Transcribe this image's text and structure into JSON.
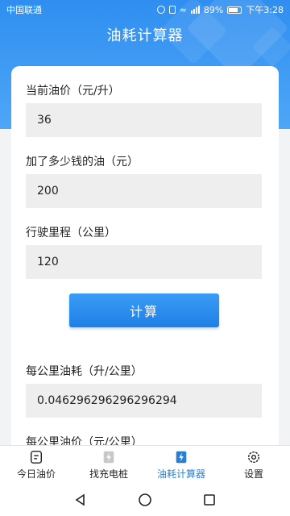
{
  "status_bar": {
    "carrier": "中国联通",
    "battery": "89%",
    "time": "下午3:28"
  },
  "header": {
    "title": "油耗计算器"
  },
  "form": {
    "price_label": "当前油价（元/升）",
    "price_value": "36",
    "cost_label": "加了多少钱的油（元）",
    "cost_value": "200",
    "distance_label": "行驶里程（公里）",
    "distance_value": "120",
    "calc_button": "计算"
  },
  "results": {
    "consumption_label": "每公里油耗（升/公里）",
    "consumption_value": "0.046296296296296294",
    "price_per_km_label": "每公里油价（元/公里）"
  },
  "tabs": [
    {
      "label": "今日油价",
      "icon": "oil-price-icon",
      "active": false
    },
    {
      "label": "找充电桩",
      "icon": "charging-icon",
      "active": false
    },
    {
      "label": "油耗计算器",
      "icon": "calculator-icon",
      "active": true
    },
    {
      "label": "设置",
      "icon": "settings-gear-icon",
      "active": false
    }
  ],
  "colors": {
    "accent": "#2a7fd4",
    "header": "#3d97f3"
  }
}
